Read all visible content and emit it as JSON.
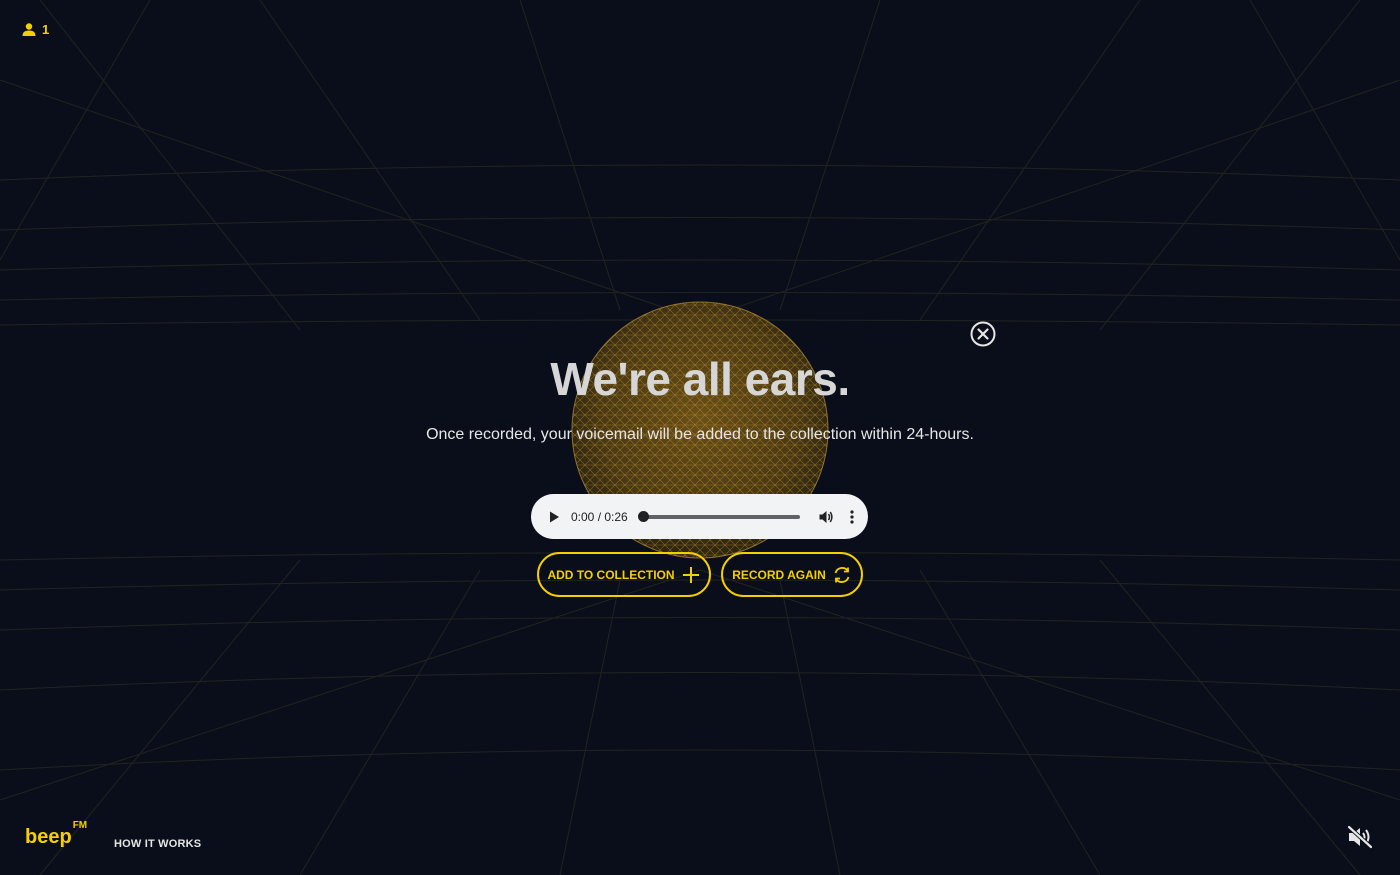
{
  "header": {
    "listener_count": "1",
    "listener_icon": "user-icon"
  },
  "modal": {
    "close_icon": "close-circle-icon",
    "title": "We're all ears.",
    "subtitle": "Once recorded, your voicemail will be added to the collection within 24-hours."
  },
  "player": {
    "current_time": "0:00",
    "duration": "0:26",
    "time_display": "0:00 / 0:26",
    "progress": 0,
    "play_icon": "play-icon",
    "volume_icon": "volume-icon",
    "menu_icon": "more-vertical-icon"
  },
  "actions": {
    "add_label": "ADD TO COLLECTION",
    "add_icon": "plus-icon",
    "record_label": "RECORD AGAIN",
    "record_icon": "refresh-icon"
  },
  "footer": {
    "logo_text": "beep",
    "logo_sup": "FM",
    "how_label": "HOW IT WORKS",
    "mute_icon": "speaker-muted-icon"
  },
  "colors": {
    "accent": "#f5d000",
    "background": "#0a0e1a",
    "sphere": "#c9961e"
  }
}
